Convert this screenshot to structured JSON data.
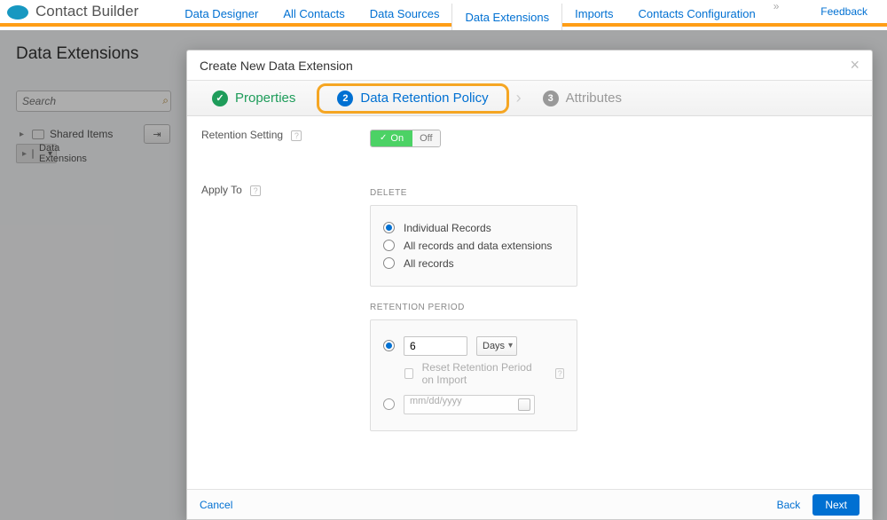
{
  "app": {
    "title": "Contact Builder"
  },
  "nav": {
    "items": [
      {
        "label": "Data Designer"
      },
      {
        "label": "All Contacts"
      },
      {
        "label": "Data Sources"
      },
      {
        "label": "Data Extensions"
      },
      {
        "label": "Imports"
      },
      {
        "label": "Contacts Configuration"
      }
    ],
    "feedback": "Feedback"
  },
  "page": {
    "heading": "Data Extensions",
    "search_placeholder": "Search",
    "tree": {
      "shared": "Shared Items",
      "ext": "Data Extensions"
    }
  },
  "modal": {
    "title": "Create New Data Extension",
    "steps": {
      "s1": "Properties",
      "s2": "Data Retention Policy",
      "s3": "Attributes",
      "n2": "2",
      "n3": "3"
    },
    "retention_label": "Retention Setting",
    "toggle": {
      "on": "On",
      "off": "Off"
    },
    "apply_label": "Apply To",
    "delete_section": "DELETE",
    "delete_opts": {
      "a": "Individual Records",
      "b": "All records and data extensions",
      "c": "All records"
    },
    "period_section": "RETENTION PERIOD",
    "period": {
      "value": "6",
      "unit": "Days",
      "reset": "Reset Retention Period on Import",
      "date_placeholder": "mm/dd/yyyy"
    },
    "footer": {
      "cancel": "Cancel",
      "back": "Back",
      "next": "Next"
    }
  }
}
